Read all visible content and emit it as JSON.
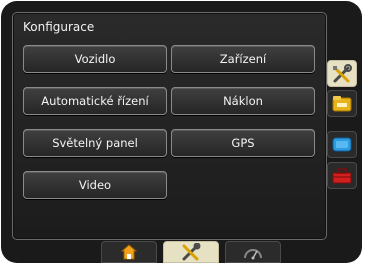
{
  "panel": {
    "title": "Konfigurace"
  },
  "buttons": {
    "vehicle": "Vozidlo",
    "devices": "Zařízení",
    "auto_steering": "Automatické řízení",
    "tilt": "Náklon",
    "lightbar": "Světelný panel",
    "gps": "GPS",
    "video": "Video"
  },
  "side_tabs": [
    {
      "icon": "wrench-screwdriver-icon",
      "active": true
    },
    {
      "icon": "folder-icon",
      "active": false
    },
    {
      "icon": "monitor-icon",
      "active": false
    },
    {
      "icon": "toolbox-icon",
      "active": false
    }
  ],
  "bottom_tabs": [
    {
      "icon": "home-icon",
      "active": false
    },
    {
      "icon": "wrench-screwdriver-icon",
      "active": true
    },
    {
      "icon": "gauge-icon",
      "active": false
    }
  ],
  "colors": {
    "active_tab": "#e7e1c4",
    "button_border": "#8a8a8a",
    "background": "#1a1a1a"
  }
}
